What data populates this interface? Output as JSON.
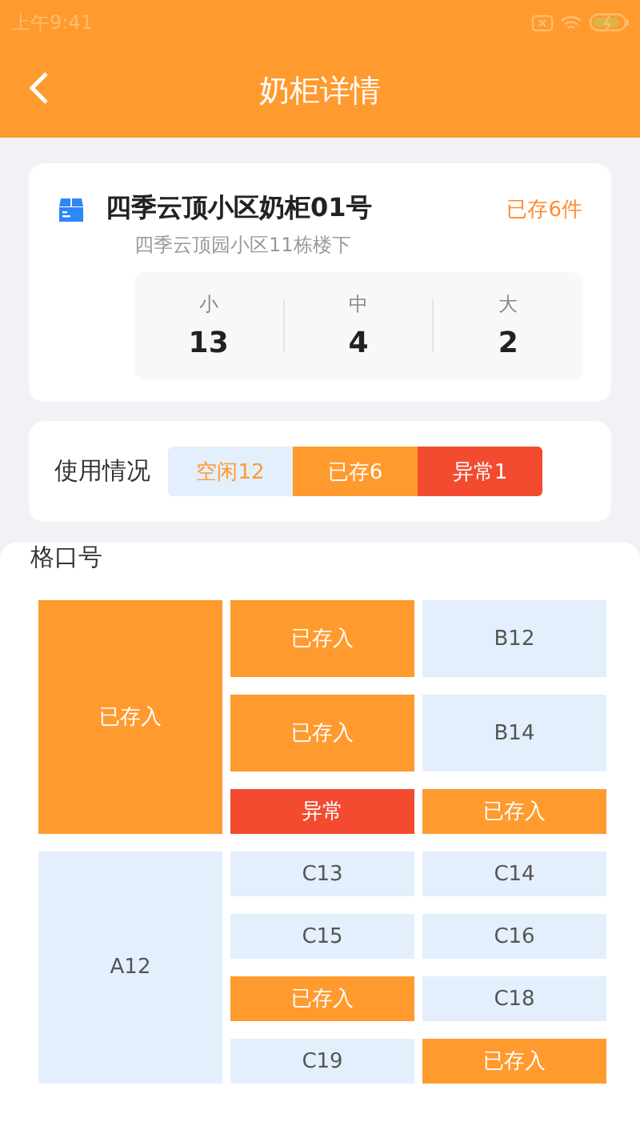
{
  "status_bar": {
    "time": "上午9:41"
  },
  "header": {
    "title": "奶柜详情"
  },
  "cabinet": {
    "name": "四季云顶小区奶柜01号",
    "stored": "已存6件",
    "address": "四季云顶园小区11栋楼下",
    "sizes": [
      {
        "label": "小",
        "count": "13"
      },
      {
        "label": "中",
        "count": "4"
      },
      {
        "label": "大",
        "count": "2"
      }
    ]
  },
  "usage": {
    "label": "使用情况",
    "segments": [
      {
        "kind": "idle",
        "text": "空闲12"
      },
      {
        "kind": "stored",
        "text": "已存6"
      },
      {
        "kind": "fault",
        "text": "异常1"
      }
    ]
  },
  "slots": {
    "title": "格口号",
    "groups": [
      {
        "big": {
          "kind": "stored",
          "text": "已存入"
        },
        "rows": [
          {
            "tall": true,
            "cells": [
              {
                "kind": "stored",
                "text": "已存入"
              },
              {
                "kind": "idle",
                "text": "B12"
              }
            ]
          },
          {
            "tall": true,
            "cells": [
              {
                "kind": "stored",
                "text": "已存入"
              },
              {
                "kind": "idle",
                "text": "B14"
              }
            ]
          },
          {
            "tall": false,
            "cells": [
              {
                "kind": "fault",
                "text": "异常"
              },
              {
                "kind": "stored",
                "text": "已存入"
              }
            ]
          }
        ]
      },
      {
        "big": {
          "kind": "idle",
          "text": "A12"
        },
        "rows": [
          {
            "tall": false,
            "cells": [
              {
                "kind": "idle",
                "text": "C13"
              },
              {
                "kind": "idle",
                "text": "C14"
              }
            ]
          },
          {
            "tall": false,
            "cells": [
              {
                "kind": "idle",
                "text": "C15"
              },
              {
                "kind": "idle",
                "text": "C16"
              }
            ]
          },
          {
            "tall": false,
            "cells": [
              {
                "kind": "stored",
                "text": "已存入"
              },
              {
                "kind": "idle",
                "text": "C18"
              }
            ]
          },
          {
            "tall": false,
            "cells": [
              {
                "kind": "idle",
                "text": "C19"
              },
              {
                "kind": "stored",
                "text": "已存入"
              }
            ]
          }
        ]
      }
    ]
  }
}
